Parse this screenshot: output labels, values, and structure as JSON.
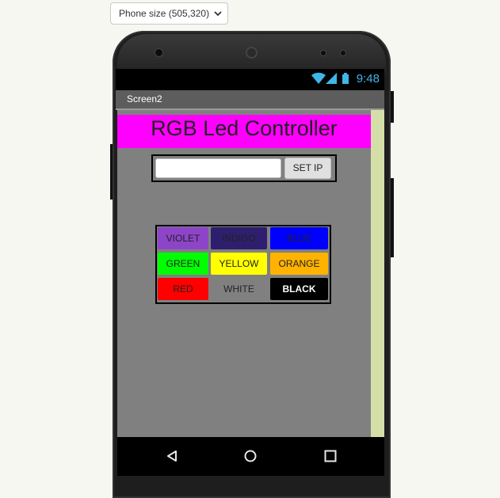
{
  "designer": {
    "screen_size_select": "Phone size (505,320)"
  },
  "status_bar": {
    "time": "9:48"
  },
  "app": {
    "screen_title": "Screen2",
    "banner": "RGB Led Controller",
    "ip_input": {
      "value": "",
      "placeholder": ""
    },
    "set_ip_label": "SET IP",
    "color_buttons": [
      {
        "label": "VIOLET",
        "bg": "#8e44c8",
        "fg": "#222222"
      },
      {
        "label": "INDIGO",
        "bg": "#2e1f6e",
        "fg": "#222222"
      },
      {
        "label": "BLUE",
        "bg": "#0000ff",
        "fg": "#222222"
      },
      {
        "label": "GREEN",
        "bg": "#00ff00",
        "fg": "#222222"
      },
      {
        "label": "YELLOW",
        "bg": "#ffff00",
        "fg": "#222222"
      },
      {
        "label": "ORANGE",
        "bg": "#ffb300",
        "fg": "#222222"
      },
      {
        "label": "RED",
        "bg": "#ff0000",
        "fg": "#222222"
      },
      {
        "label": "WHITE",
        "bg": "#808080",
        "fg": "#222222"
      },
      {
        "label": "BLACK",
        "bg": "#000000",
        "fg": "#ffffff"
      }
    ]
  },
  "colors": {
    "accent_status": "#3fb6e8",
    "banner_bg": "#ff00ff",
    "screen_bg": "#808080"
  },
  "icons": [
    "chevron-down-icon",
    "wifi-icon",
    "signal-icon",
    "battery-icon",
    "back-icon",
    "home-icon",
    "recents-icon"
  ]
}
